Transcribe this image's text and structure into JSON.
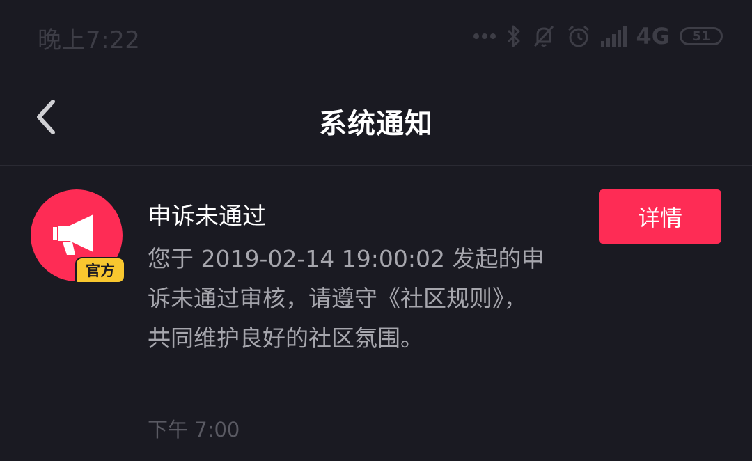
{
  "status_bar": {
    "time": "晚上7:22",
    "network": "4G",
    "battery": "51",
    "icons": [
      "dots-icon",
      "bluetooth-icon",
      "mute-icon",
      "alarm-icon",
      "signal-icon",
      "battery-icon"
    ]
  },
  "nav": {
    "title": "系统通知",
    "back_icon": "chevron-left-icon"
  },
  "notification": {
    "title": "申诉未通过",
    "body": "您于 2019-02-14 19:00:02 发起的申诉未通过审核，请遵守《社区规则》，共同维护良好的社区氛围。",
    "time": "下午 7:00",
    "badge": "官方",
    "detail_label": "详情",
    "avatar_icon": "megaphone-icon"
  },
  "colors": {
    "background": "#1a1a22",
    "accent": "#fe2c55",
    "badge": "#f8c72f",
    "body_text": "#a6a6ad",
    "muted_text": "#5a5a63"
  }
}
